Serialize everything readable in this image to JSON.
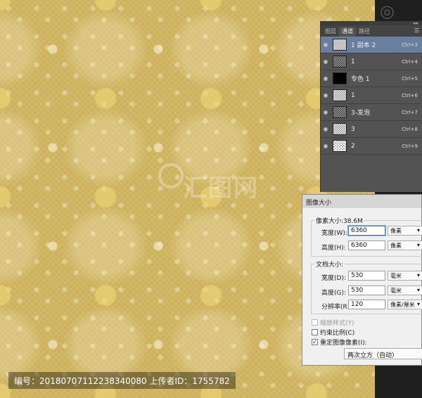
{
  "channels_panel": {
    "tabs": [
      "图层",
      "通道",
      "路径"
    ],
    "active_tab": 1,
    "rows": [
      {
        "name": "1 副本 2",
        "shortcut": "Ctrl+3",
        "thumb": "noise",
        "selected": true
      },
      {
        "name": "1",
        "shortcut": "Ctrl+4",
        "thumb": "dark-noise",
        "selected": false
      },
      {
        "name": "专色 1",
        "shortcut": "Ctrl+5",
        "thumb": "black",
        "selected": false
      },
      {
        "name": "1",
        "shortcut": "Ctrl+6",
        "thumb": "noise",
        "selected": false
      },
      {
        "name": "3-发泡",
        "shortcut": "Ctrl+7",
        "thumb": "dark-noise",
        "selected": false
      },
      {
        "name": "3",
        "shortcut": "Ctrl+8",
        "thumb": "noise",
        "selected": false
      },
      {
        "name": "2",
        "shortcut": "Ctrl+9",
        "thumb": "light",
        "selected": false
      }
    ]
  },
  "dialog": {
    "title": "图像大小",
    "pixel_dimensions_label": "像素大小:38.6M",
    "width_label": "宽度(W):",
    "width_value": "6360",
    "width_unit": "像素",
    "height_label": "高度(H):",
    "height_value": "6360",
    "height_unit": "像素",
    "doc_size_label": "文档大小:",
    "doc_width_label": "宽度(D):",
    "doc_width_value": "530",
    "doc_width_unit": "毫米",
    "doc_height_label": "高度(G):",
    "doc_height_value": "530",
    "doc_height_unit": "毫米",
    "resolution_label": "分辨率(R):",
    "resolution_value": "120",
    "resolution_unit": "像素/厘米",
    "scale_styles_label": "缩放样式(Y)",
    "constrain_label": "约束比例(C)",
    "resample_label": "重定图像像素(I):",
    "resample_method": "两次立方（自动）"
  },
  "watermark": {
    "center_text": "汇图网",
    "caption": "编号：20180707112238340080 上传者ID：1755782"
  }
}
